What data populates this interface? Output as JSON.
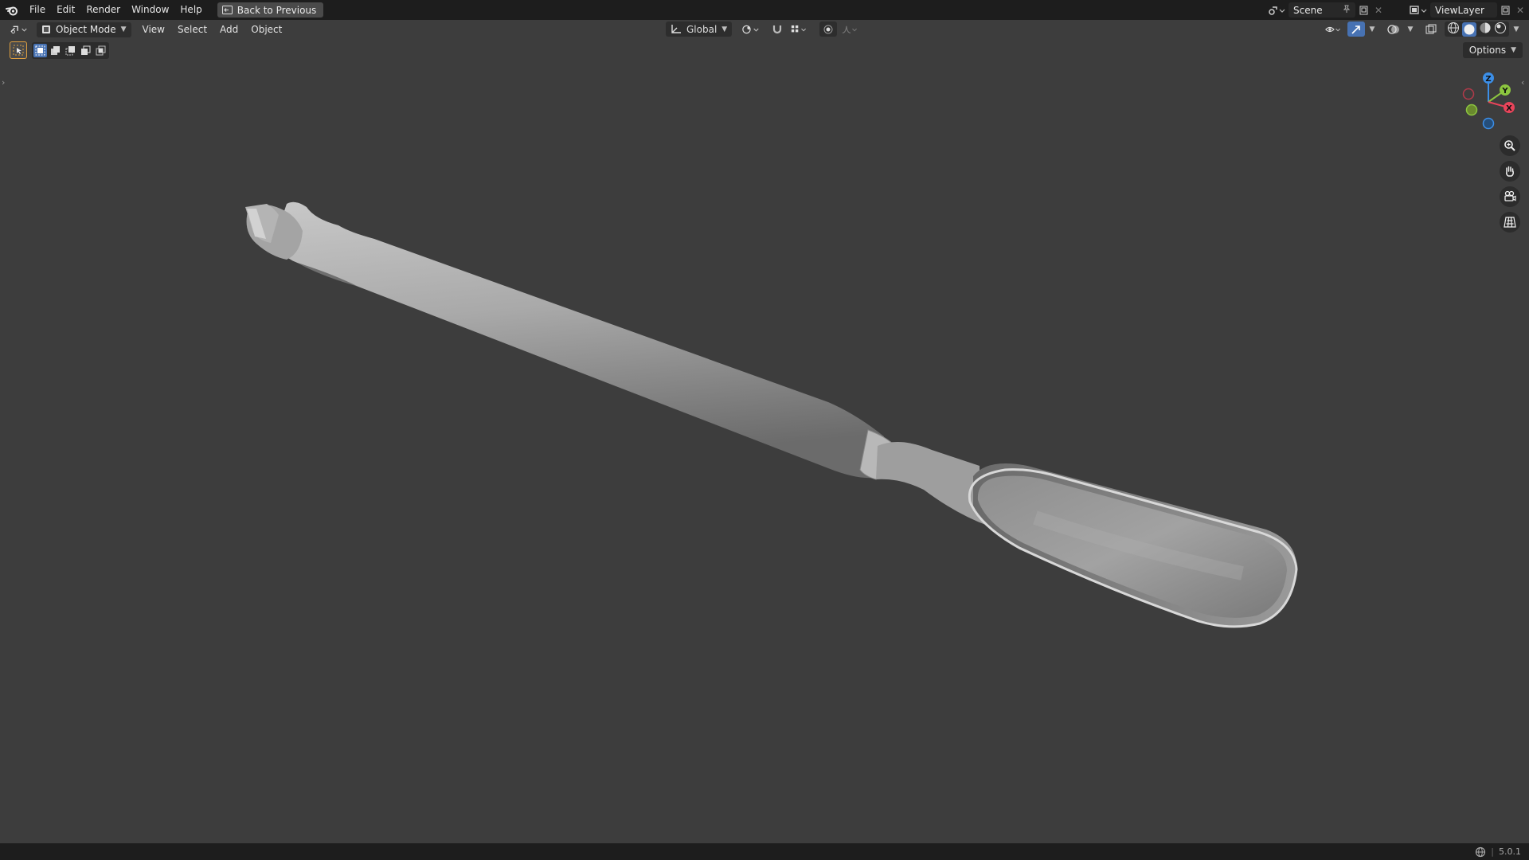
{
  "topbar": {
    "menus": [
      "File",
      "Edit",
      "Render",
      "Window",
      "Help"
    ],
    "back_button": "Back to Previous",
    "scene_name": "Scene",
    "view_layer": "ViewLayer"
  },
  "header": {
    "mode": "Object Mode",
    "menus": [
      "View",
      "Select",
      "Add",
      "Object"
    ],
    "transform_orientation": "Global",
    "options": "Options"
  },
  "status": {
    "version": "5.0.1"
  },
  "gizmo": {
    "x_label": "X",
    "y_label": "Y",
    "z_label": "Z",
    "colors": {
      "x": "#e8445a",
      "y": "#8cc63f",
      "z": "#3c8fe8"
    }
  },
  "theme": {
    "accent": "#4772b3",
    "background": "#3d3d3d"
  }
}
